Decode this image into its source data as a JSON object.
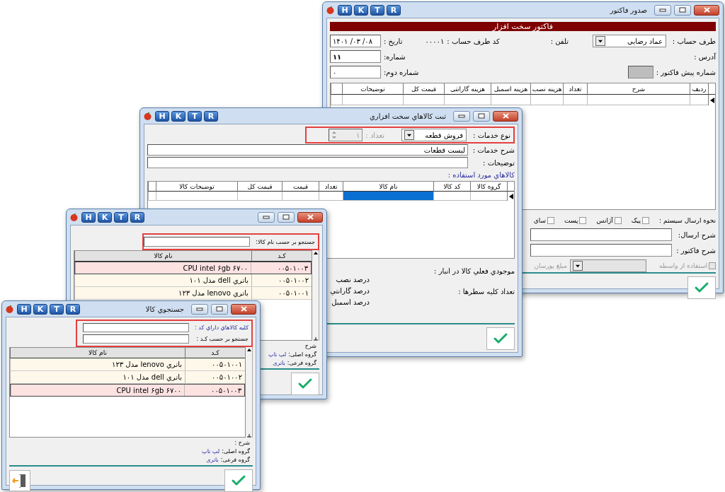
{
  "invoice_window": {
    "title": "صدور فاکتور",
    "toolbar": [
      "R",
      "T",
      "K",
      "H"
    ],
    "banner": "فاکتور سخت افزار",
    "account": {
      "label": "طرف حساب :",
      "value": "عماد رضایی"
    },
    "phone": {
      "label": "تلفن :"
    },
    "account_code": {
      "label": "کد طرف حساب :",
      "value": "۰۰۰۰۱"
    },
    "date": {
      "label": "تاریخ :",
      "value": "۱۴۰۱ /۰۳ /۰۸"
    },
    "address": {
      "label": "آدرس :"
    },
    "number": {
      "label": "شماره:",
      "value": "۱۱"
    },
    "second_number": {
      "label": "شماره دوم:",
      "value": "۰"
    },
    "proforma": {
      "label": "شماره پیش فاکتور :",
      "disabled": true
    },
    "table": {
      "columns": [
        "ردیف",
        "شرح",
        "تعداد",
        "هزینه نصب",
        "هزینه اسمبل",
        "هزینه گارانتی",
        "قیمت کل",
        "توضیحات"
      ]
    },
    "shipping": {
      "label": "نحوه ارسال سیستم :",
      "options": [
        {
          "label": "پیک",
          "checked": false
        },
        {
          "label": "آژانس",
          "checked": false
        },
        {
          "label": "پست",
          "checked": false
        },
        {
          "label": "ساي",
          "checked": false
        }
      ]
    },
    "shipping_desc": {
      "label": "شرح ارسال:"
    },
    "invoice_desc": {
      "label": "شرح فاکتور :"
    },
    "intermediary": {
      "label": "استفاده از واسطه",
      "checked": false,
      "disabled": true
    },
    "commission": {
      "label": "مبلغ پورسان",
      "disabled": true
    }
  },
  "service_window": {
    "title": "ثبت كالاهاي سخت افزاري",
    "toolbar": [
      "R",
      "T",
      "K",
      "H"
    ],
    "service_type": {
      "label": "نوع خدمات :",
      "value": "فروش قطعه"
    },
    "quantity": {
      "label": "تعداد :",
      "value": "۱",
      "disabled": true
    },
    "service_desc": {
      "label": "شرح خدمات :",
      "value": "لیست قطعات"
    },
    "notes": {
      "label": "توضیحات :"
    },
    "items_label": "كالاهاي مورد استفاده :",
    "items_table": {
      "columns": [
        "گروه كالا",
        "كد كالا",
        "نام كالا",
        "تعداد",
        "قيمت",
        "قيمت كل",
        "توضيحات كالا"
      ],
      "rows": [
        {
          "cells": [
            {
              "selected": false
            },
            {
              "selected": false
            },
            {
              "selected": true
            },
            {
              "selected": false
            },
            {
              "selected": false
            },
            {
              "selected": false
            },
            {
              "selected": false
            }
          ]
        }
      ]
    },
    "stock_label": "موجودي فعلي كالا در انبار :",
    "rows_count_label": "تعداد كليه سطرها :",
    "percent_labels": [
      "درصد نصب",
      "درصد گارانتي",
      "درصد اسمبل"
    ]
  },
  "name_search_window": {
    "toolbar": [
      "R",
      "T",
      "K",
      "H"
    ],
    "search": {
      "label": "جستجو بر حسب نام كالا:"
    },
    "results": {
      "columns": [
        "كـد",
        "نام كالا"
      ],
      "rows": [
        {
          "code": "۰۰۵۰۱۰۰۳",
          "name": "CPU intel ۶gb ۶۷۰۰",
          "selected": true
        },
        {
          "code": "۰۰۵۰۱۰۰۲",
          "name": "باتري dell مدل ۱۰۱",
          "selected": false
        },
        {
          "code": "۰۰۵۰۱۰۰۱",
          "name": "باتري lenovo مدل ۱۲۳",
          "selected": false
        }
      ]
    },
    "info": {
      "desc_label": "شرح",
      "main_group_label": "گروه اصلی:",
      "main_group": "لپ تاپ",
      "sub_group_label": "گروه فرعی:",
      "sub_group": "باتری"
    }
  },
  "code_search_window": {
    "title": "جستجوي كالا",
    "toolbar": [
      "R",
      "T",
      "K",
      "H"
    ],
    "code_filter": {
      "label": "كليه كالاهاي داراي كد :"
    },
    "code_search": {
      "label": "جستجو بر حسب كـد :"
    },
    "results": {
      "columns": [
        "كـد",
        "نام كالا"
      ],
      "rows": [
        {
          "code": "۰۰۵۰۱۰۰۱",
          "name": "باتري lenovo مدل ۱۲۳",
          "selected": false
        },
        {
          "code": "۰۰۵۰۱۰۰۲",
          "name": "باتري dell مدل ۱۰۱",
          "selected": false
        },
        {
          "code": "۰۰۵۰۱۰۰۳",
          "name": "CPU intel ۶gb ۶۷۰۰",
          "selected": true
        }
      ]
    },
    "info": {
      "desc_label": "شرح :",
      "main_group_label": "گروه اصلی:",
      "main_group": "لپ تاپ",
      "sub_group_label": "گروه فرعی:",
      "sub_group": "باتری"
    }
  }
}
